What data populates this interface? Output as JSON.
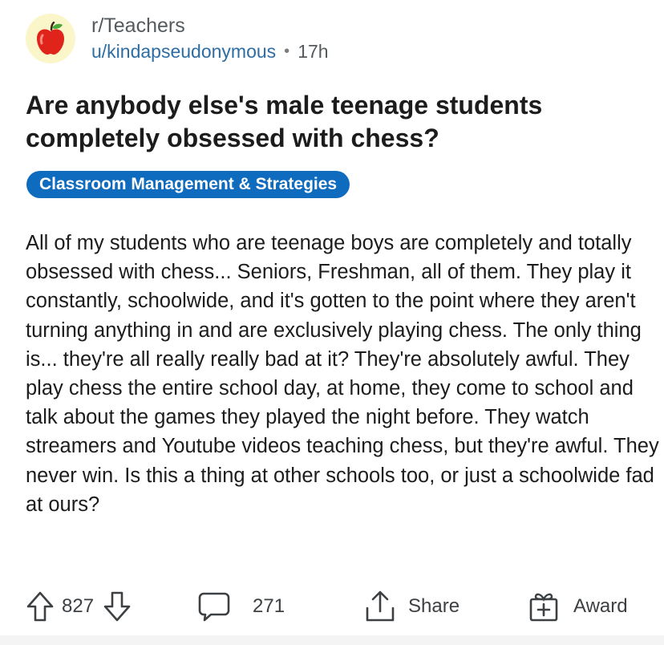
{
  "post": {
    "subreddit": "r/Teachers",
    "author": "u/kindapseudonymous",
    "separator": "•",
    "time_ago": "17h",
    "title": "Are anybody else's male teenage students completely obsessed with chess?",
    "flair": "Classroom Management & Strategies",
    "body": "All of my students who are teenage boys are completely and totally obsessed with chess... Seniors, Freshman, all of them. They play it constantly, schoolwide, and it's gotten to the point where they aren't turning anything in and are exclusively playing chess. The only thing is... they're all really really bad at it? They're absolutely awful. They play chess the entire school day, at home, they come to school and talk about the games they played the night before. They watch streamers and Youtube videos teaching chess, but they're awful. They never win. Is this a thing at other schools too, or just a schoolwide fad at ours?"
  },
  "actions": {
    "upvotes": "827",
    "comments": "271",
    "share_label": "Share",
    "award_label": "Award"
  },
  "icons": {
    "avatar": "apple-icon",
    "upvote": "arrow-up-icon",
    "downvote": "arrow-down-icon",
    "comments": "speech-bubble-icon",
    "share": "share-icon",
    "award": "gift-icon"
  },
  "colors": {
    "flair_bg": "#0e6bbe",
    "author": "#2d6da3",
    "avatar_bg": "#fbf6c9",
    "apple": "#e0231b"
  }
}
